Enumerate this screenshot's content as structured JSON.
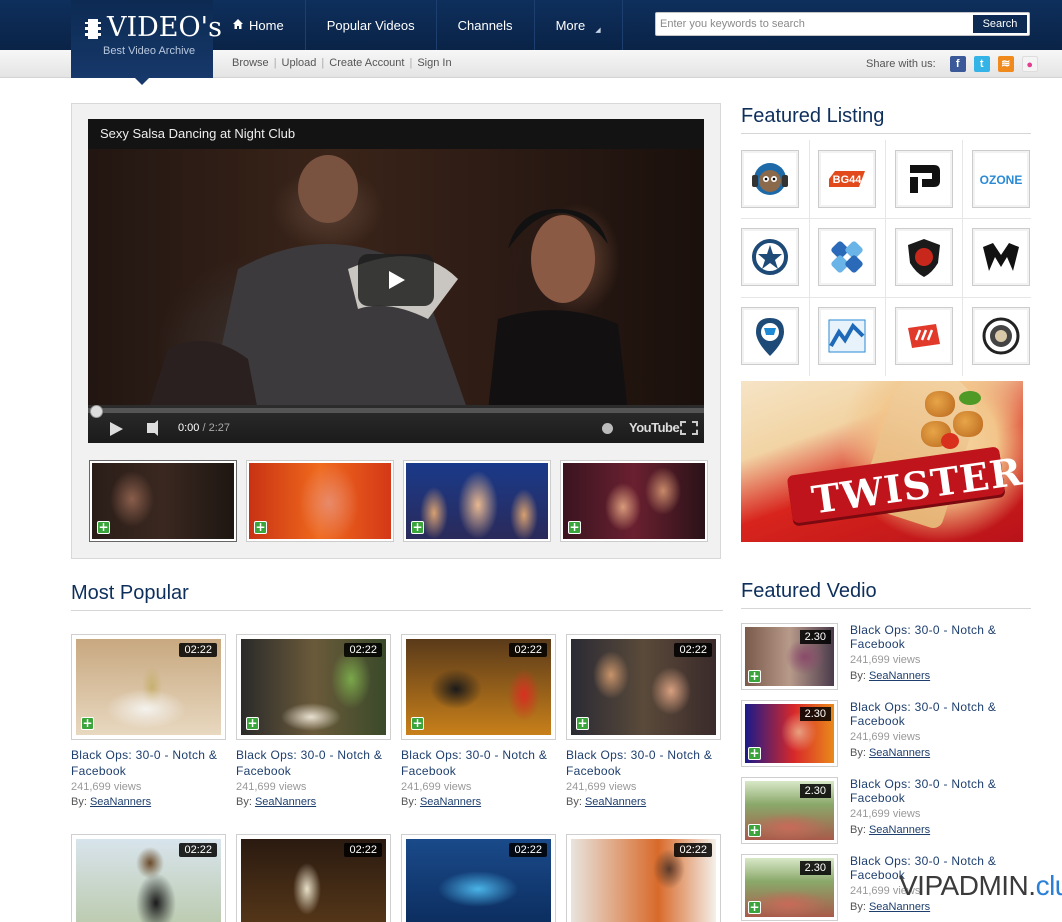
{
  "brand": {
    "title": "VIDEO's",
    "tagline": "Best Video Archive"
  },
  "nav": {
    "items": [
      {
        "label": "Home",
        "icon": "house-icon"
      },
      {
        "label": "Popular Videos"
      },
      {
        "label": "Channels"
      },
      {
        "label": "More",
        "icon": "chevron-down-icon"
      }
    ]
  },
  "search": {
    "placeholder": "Enter you keywords to search",
    "button": "Search"
  },
  "subnav": {
    "links": [
      "Browse",
      "Upload",
      "Create Account",
      "Sign In"
    ]
  },
  "share": {
    "label": "Share with us:",
    "icons": [
      {
        "name": "facebook-icon",
        "glyph": "f",
        "color": "#3b5998"
      },
      {
        "name": "twitter-icon",
        "glyph": "t",
        "color": "#33b3e6"
      },
      {
        "name": "rss-icon",
        "glyph": "≋",
        "color": "#f08a1c"
      },
      {
        "name": "flickr-icon",
        "glyph": "●",
        "color": "#e23d8e"
      }
    ]
  },
  "player": {
    "title": "Sexy Salsa Dancing at Night Club",
    "time_current": "0:00",
    "time_total": "/ 2:27",
    "brand": "YouTube",
    "progress": 0
  },
  "featured_listing": {
    "title": "Featured Listing",
    "brands": [
      "monkey-headphones-logo",
      "bg44-logo",
      "p-letter-logo",
      "ozone-logo",
      "star-shield-logo",
      "chain-links-logo",
      "lion-shield-logo",
      "m-letter-logo",
      "cart-pin-logo",
      "chart-wave-logo",
      "red-stripes-logo",
      "lion-badge-logo"
    ],
    "brand_labels": {
      "bg44": "BG44",
      "ozone": "OZONE"
    }
  },
  "ad": {
    "text": "TWISTER"
  },
  "most_popular": {
    "title": "Most Popular",
    "cards": [
      {
        "duration": "02:22",
        "title": "Black Ops: 30-0 - Notch & Facebook",
        "views": "241,699 views",
        "by": "By:",
        "author": "SeaNanners"
      },
      {
        "duration": "02:22",
        "title": "Black Ops: 30-0 - Notch & Facebook",
        "views": "241,699 views",
        "by": "By:",
        "author": "SeaNanners"
      },
      {
        "duration": "02:22",
        "title": "Black Ops: 30-0 - Notch & Facebook",
        "views": "241,699 views",
        "by": "By:",
        "author": "SeaNanners"
      },
      {
        "duration": "02:22",
        "title": "Black Ops: 30-0 - Notch & Facebook",
        "views": "241,699 views",
        "by": "By:",
        "author": "SeaNanners"
      },
      {
        "duration": "02:22"
      },
      {
        "duration": "02:22"
      },
      {
        "duration": "02:22"
      },
      {
        "duration": "02:22"
      }
    ]
  },
  "featured_video": {
    "title": "Featured Vedio",
    "items": [
      {
        "duration": "2.30",
        "title": "Black Ops: 30-0 - Notch & Facebook",
        "views": "241,699 views",
        "by": "By:",
        "author": "SeaNanners"
      },
      {
        "duration": "2.30",
        "title": "Black Ops: 30-0 - Notch & Facebook",
        "views": "241,699 views",
        "by": "By:",
        "author": "SeaNanners"
      },
      {
        "duration": "2.30",
        "title": "Black Ops: 30-0 - Notch & Facebook",
        "views": "241,699 views",
        "by": "By:",
        "author": "SeaNanners"
      },
      {
        "duration": "2.30",
        "title": "Black Ops: 30-0 - Notch & Facebook",
        "views": "241,699 views",
        "by": "By:",
        "author": "SeaNanners"
      }
    ]
  },
  "watermark": {
    "part1": "VIPADMIN.",
    "part2": "club"
  }
}
